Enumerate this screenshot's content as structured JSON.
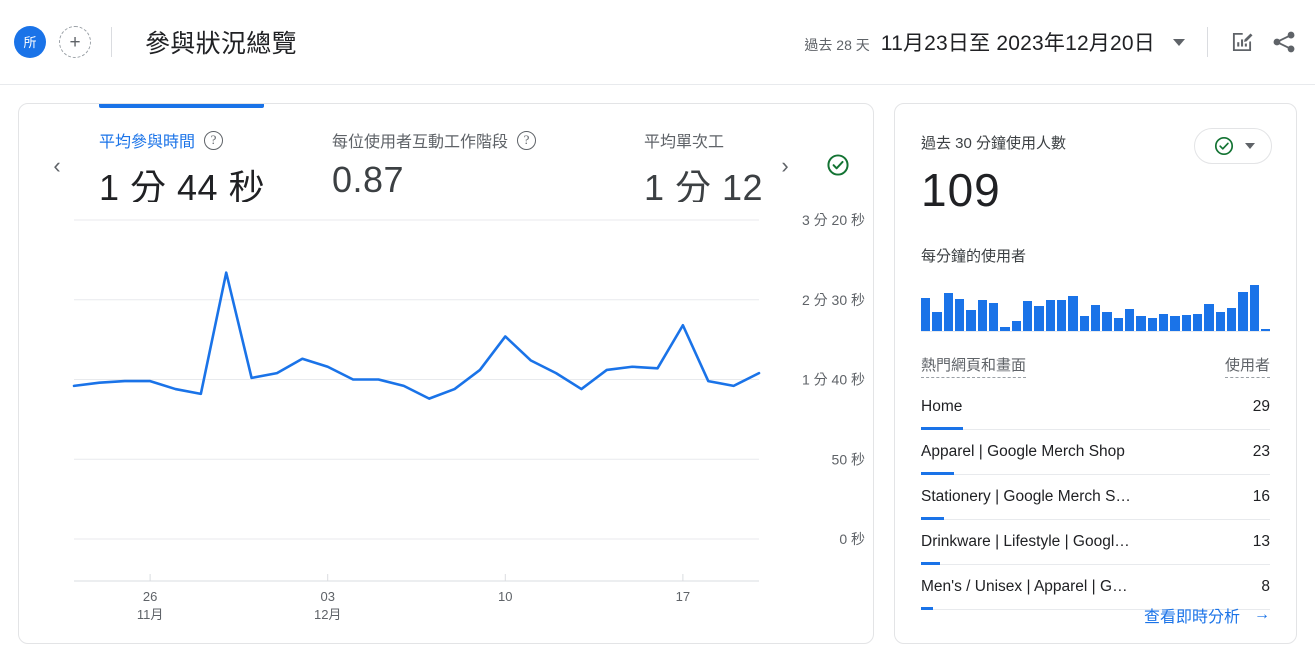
{
  "header": {
    "account_badge": "所",
    "add_button": "+",
    "title": "參與狀況總覽",
    "date_prefix": "過去 28 天",
    "date_value": "11月23日至 2023年12月20日",
    "edit_icon": "edit-chart-icon",
    "share_icon": "share-icon",
    "caret_icon": "chevron-down-icon"
  },
  "metrics": {
    "prev_arrow": "‹",
    "next_arrow": "›",
    "items": [
      {
        "label": "平均參與時間",
        "value": "1 分 44 秒",
        "active": true
      },
      {
        "label": "每位使用者互動工作階段",
        "value": "0.87",
        "active": false
      },
      {
        "label": "平均單次工",
        "value": "1 分 12",
        "active": false
      }
    ],
    "status_badge": "check-circle-icon"
  },
  "chart_data": {
    "type": "line",
    "title": "平均參與時間",
    "xlabel": "",
    "ylabel": "",
    "ylim": [
      0,
      200
    ],
    "yticks": [
      0,
      50,
      100,
      150,
      200
    ],
    "ytick_labels": [
      "0 秒",
      "50 秒",
      "1 分 40 秒",
      "2 分 30 秒",
      "3 分 20 秒"
    ],
    "grid": true,
    "legend": "none",
    "line_color": "#1a73e8",
    "xtick_positions": [
      3,
      10,
      17,
      24
    ],
    "xtick_labels": [
      "26",
      "03",
      "10",
      "17"
    ],
    "xtick_sublabels": [
      "11月",
      "12月",
      "",
      ""
    ],
    "x": [
      0,
      1,
      2,
      3,
      4,
      5,
      6,
      7,
      8,
      9,
      10,
      11,
      12,
      13,
      14,
      15,
      16,
      17,
      18,
      19,
      20,
      21,
      22,
      23,
      24,
      25,
      26,
      27
    ],
    "values": [
      96,
      98,
      99,
      99,
      94,
      91,
      167,
      101,
      104,
      113,
      108,
      100,
      100,
      96,
      88,
      94,
      106,
      127,
      112,
      104,
      94,
      106,
      108,
      107,
      134,
      99,
      96,
      104
    ]
  },
  "realtime": {
    "title": "過去 30 分鐘使用人數",
    "value": "109",
    "subtitle": "每分鐘的使用者",
    "status_badge": "check-circle-icon",
    "caret_icon": "chevron-down-icon",
    "sparkline": {
      "type": "bar",
      "label": "每分鐘的使用者",
      "values": [
        32,
        18,
        36,
        31,
        20,
        30,
        27,
        4,
        10,
        29,
        24,
        30,
        30,
        33,
        14,
        25,
        18,
        12,
        21,
        14,
        12,
        16,
        14,
        15,
        16,
        26,
        18,
        22,
        37,
        44,
        2
      ],
      "bar_color": "#1a73e8"
    },
    "table": {
      "col_name": "熱門網頁和畫面",
      "col_value": "使用者",
      "rows": [
        {
          "name": "Home",
          "value": "29",
          "pct": 100
        },
        {
          "name": "Apparel | Google Merch Shop",
          "value": "23",
          "pct": 79
        },
        {
          "name": "Stationery | Google Merch S…",
          "value": "16",
          "pct": 55
        },
        {
          "name": "Drinkware | Lifestyle | Googl…",
          "value": "13",
          "pct": 45
        },
        {
          "name": "Men's / Unisex | Apparel | G…",
          "value": "8",
          "pct": 28
        }
      ]
    },
    "footer_link": "查看即時分析",
    "footer_arrow": "→"
  }
}
